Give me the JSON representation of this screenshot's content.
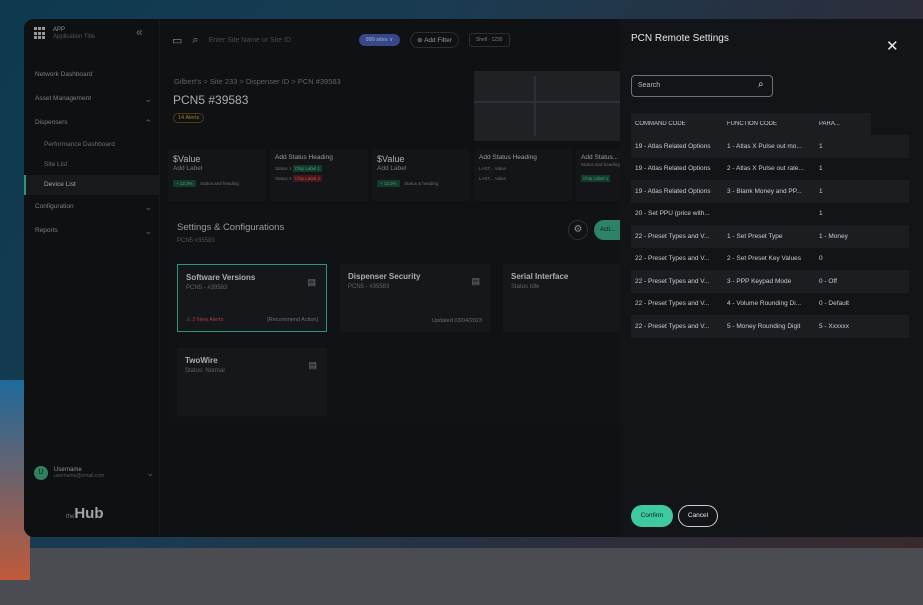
{
  "app": {
    "title": "APP",
    "subtitle": "Application Title"
  },
  "sidebar": {
    "items": [
      {
        "label": "Network Dashboard"
      },
      {
        "label": "Asset Management"
      },
      {
        "label": "Dispensers"
      },
      {
        "label": "Configuration"
      },
      {
        "label": "Reports"
      }
    ],
    "sub_items": [
      {
        "label": "Performance Dashboard"
      },
      {
        "label": "Site List"
      },
      {
        "label": "Device List"
      }
    ],
    "user": {
      "initial": "U",
      "name": "Username",
      "email": "username@email.com"
    },
    "logo": {
      "prefix": "the",
      "name": "Hub"
    }
  },
  "topbar": {
    "search_placeholder": "Enter Site Name or Site ID",
    "sites_pill": "999 sites ∨",
    "add_filter": "Add Filter",
    "segment_a": "Shell",
    "segment_b": "1230"
  },
  "breadcrumb": "Gilbert's  >  Site 233  >  Dispenser ID  >  PCN #39583",
  "page": {
    "title": "PCN5 #39583",
    "alerts": "14 Alerts"
  },
  "stats": [
    {
      "value": "$Value",
      "label": "Add Label",
      "chip": "+ 12.3%",
      "note": "Status and heading"
    },
    {
      "heading": "Add Status Heading",
      "row1": "Status 1",
      "chip1": "Chip Label 1",
      "row2": "Status 2",
      "chip2": "Chip Label 2"
    },
    {
      "value": "$Value",
      "label": "Add Label",
      "chip": "+ 12.3%",
      "note": "Status & heading"
    },
    {
      "heading": "Add Status Heading",
      "r1": "LAST...",
      "v1": "Value",
      "r2": "LAST...",
      "v2": "Value"
    },
    {
      "heading": "Add Status...",
      "sub": "Status and heading",
      "chip": "Chip Label 1"
    }
  ],
  "settings": {
    "title": "Settings & Configurations",
    "subtitle": "PCN5 #35583",
    "action": "Acti...",
    "cards": [
      {
        "title": "Software Versions",
        "sub": "PCN5 - #39583",
        "foot_left": "⚠ 2 New Alerts",
        "foot_right": "[Recommend Action]"
      },
      {
        "title": "Dispenser Security",
        "sub": "PCN5 - #35583",
        "foot_right": "Updated 03/04/2023"
      },
      {
        "title": "Serial Interface",
        "sub": "Status Idle"
      },
      {
        "title": "TwoWire",
        "sub": "Status: Normal"
      }
    ]
  },
  "panel": {
    "title": "PCN Remote Settings",
    "search_placeholder": "Search",
    "columns": [
      "COMMAND CODE",
      "FUNCTION CODE",
      "PARA..."
    ],
    "rows": [
      [
        "19 - Atlas Related Options",
        "1 - Atlas X Pulse out mo...",
        "1"
      ],
      [
        "19 - Atlas Related Options",
        "2 - Atlas X Pulse out rate...",
        "1"
      ],
      [
        "19 - Atlas Related Options",
        "3 - Blank Money and PP...",
        "1"
      ],
      [
        "20 - Set PPU (price with...",
        "",
        "1"
      ],
      [
        "22 - Preset Types and V...",
        "1 - Set Preset Type",
        "1 - Money"
      ],
      [
        "22 - Preset Types and V...",
        "2 - Set Preset Key Values",
        "0"
      ],
      [
        "22 - Preset Types and V...",
        "3 - PPP Keypad Mode",
        "0 - Off"
      ],
      [
        "22 - Preset Types and V...",
        "4 - Volume Rounding Di...",
        "0 - Default"
      ],
      [
        "22 - Preset Types and V...",
        "5 - Money Rounding Digit",
        "5 - Xxxxxx"
      ]
    ],
    "confirm": "Confirm",
    "cancel": "Cancel"
  },
  "colors": {
    "accent": "#3fc9a0",
    "alert": "#e0584e",
    "pill": "#4a5fb8"
  }
}
